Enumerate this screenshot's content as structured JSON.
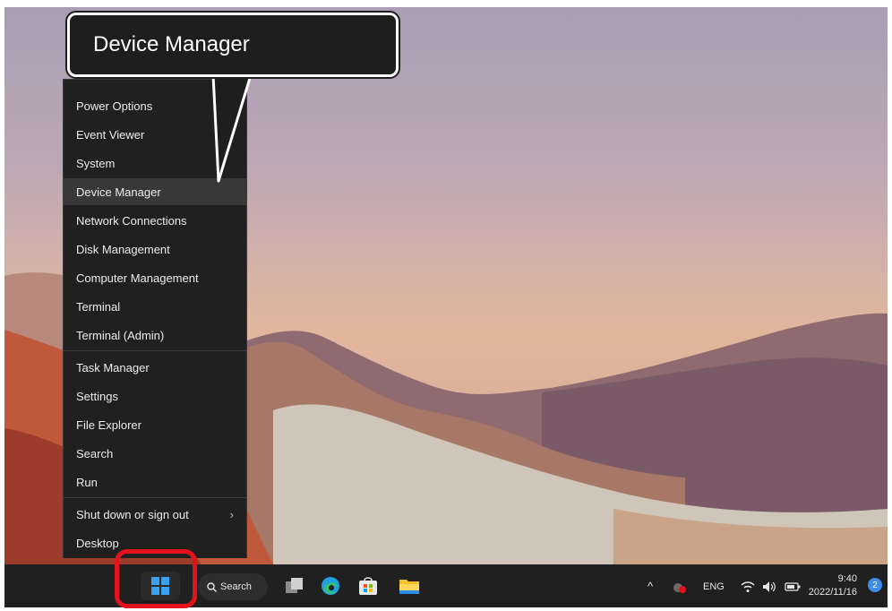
{
  "callout": {
    "title": "Device Manager"
  },
  "menu": {
    "items": [
      {
        "label": "Power Options"
      },
      {
        "label": "Event Viewer"
      },
      {
        "label": "System"
      },
      {
        "label": "Device Manager",
        "highlighted": true
      },
      {
        "label": "Network Connections"
      },
      {
        "label": "Disk Management"
      },
      {
        "label": "Computer Management"
      },
      {
        "label": "Terminal"
      },
      {
        "label": "Terminal (Admin)"
      },
      {
        "label": "Task Manager"
      },
      {
        "label": "Settings"
      },
      {
        "label": "File Explorer"
      },
      {
        "label": "Search"
      },
      {
        "label": "Run"
      },
      {
        "label": "Shut down or sign out",
        "submenu_indicator": "›"
      },
      {
        "label": "Desktop"
      }
    ]
  },
  "taskbar": {
    "search_label": "Search",
    "apps": [
      "task-view",
      "edge",
      "microsoft-store",
      "file-explorer"
    ],
    "tray": {
      "overflow_glyph": "^",
      "language": "ENG",
      "time": "9:40",
      "date": "2022/11/16",
      "notification_count": "2"
    }
  },
  "colors": {
    "menu_bg": "#202020",
    "highlight": "#383838",
    "taskbar_bg": "#202020",
    "start_ring": "#e3121b",
    "windows_blue": "#3aa0f0"
  }
}
